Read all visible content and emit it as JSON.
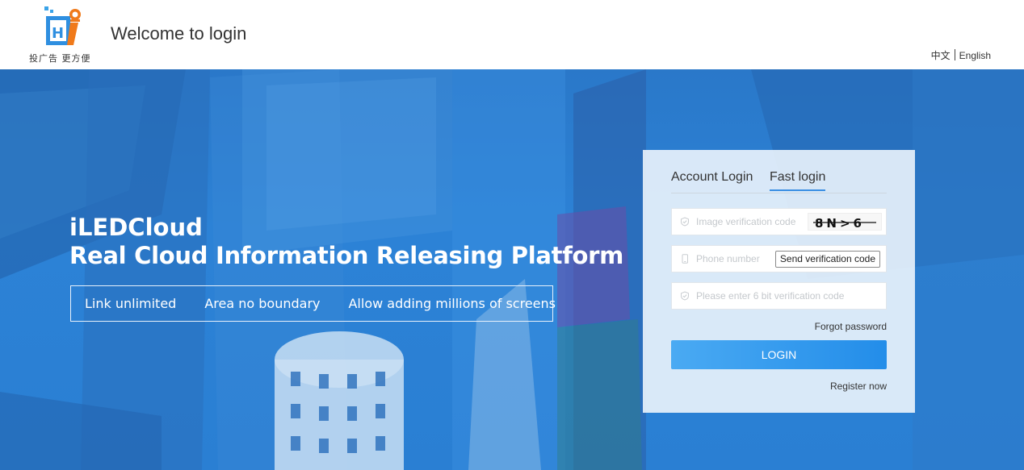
{
  "header": {
    "welcome": "Welcome to login",
    "logo_slogan": "投广告 更方便",
    "lang_zh": "中文",
    "lang_en": "English"
  },
  "hero": {
    "title1": "iLEDCloud",
    "title2": "Real Cloud Information Releasing Platform",
    "features": [
      "Link unlimited",
      "Area no boundary",
      "Allow adding millions of screens"
    ]
  },
  "login": {
    "tabs": [
      "Account Login",
      "Fast login"
    ],
    "active_tab": "Fast login",
    "image_code_placeholder": "Image verification code",
    "captcha_text": "8N>6",
    "phone_placeholder": "Phone number",
    "send_code_label": "Send verification code",
    "sms_code_placeholder": "Please enter 6 bit verification code",
    "forgot_label": "Forgot password",
    "login_label": "LOGIN",
    "register_label": "Register now"
  },
  "colors": {
    "accent": "#238de9",
    "banner": "#2a7fd3"
  }
}
